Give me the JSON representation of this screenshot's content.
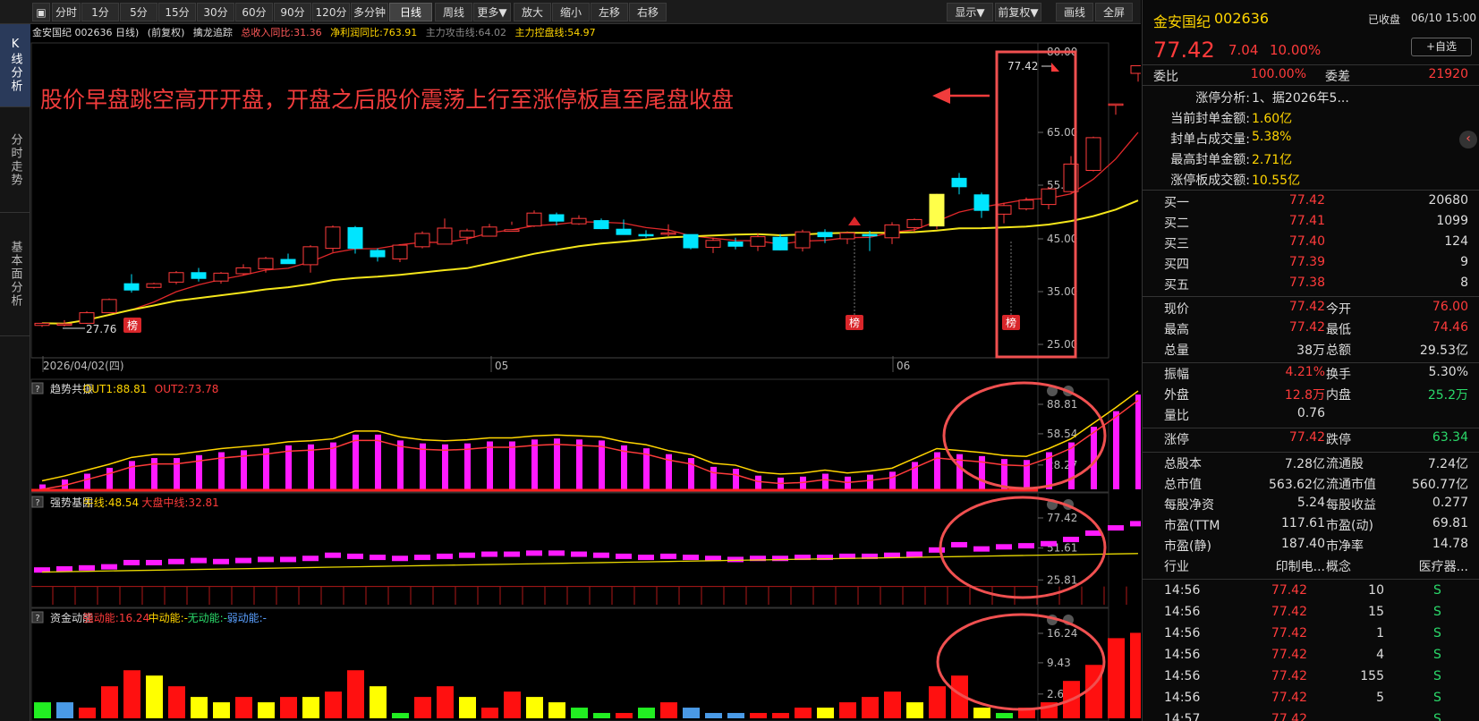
{
  "toolbar": {
    "period_buttons": [
      "分时",
      "1分",
      "5分",
      "15分",
      "30分",
      "60分",
      "90分",
      "120分",
      "多分钟",
      "日线",
      "周线",
      "更多▼",
      "放大",
      "缩小",
      "左移",
      "右移"
    ],
    "active": "日线",
    "right_buttons": [
      "显示▼",
      "前复权▼",
      "画线",
      "全屏"
    ]
  },
  "left_tabs": [
    "K线分析",
    "分时走势",
    "基本面分析"
  ],
  "info_bar": {
    "title": "金安国纪 002636 日线)",
    "fq": "(前复权)",
    "indicator": "擒龙追踪",
    "revenue": "总收入同比:31.36",
    "profit": "净利润同比:763.91",
    "attack": "主力攻击线:64.02",
    "control": "主力控盘线:54.97"
  },
  "annotation": "股价早盘跳空高开开盘，开盘之后股价震荡上行至涨停板直至尾盘收盘",
  "colors": {
    "up": "#ff3b3b",
    "down": "#00e5ff",
    "ma_short": "#e0282a",
    "ma_long": "#f5e61a",
    "magenta": "#ff1aff",
    "circle": "#f05050"
  },
  "chart_data": {
    "type": "candlestick",
    "candles": [
      [
        28.6,
        29.1,
        28.3,
        29.0
      ],
      [
        28.8,
        29.6,
        28.4,
        28.9
      ],
      [
        29.0,
        31.3,
        28.9,
        31.0
      ],
      [
        31.0,
        33.7,
        30.9,
        33.5
      ],
      [
        36.5,
        38.3,
        34.8,
        35.3
      ],
      [
        35.8,
        36.7,
        35.6,
        36.5
      ],
      [
        36.8,
        38.9,
        36.4,
        38.6
      ],
      [
        38.6,
        39.5,
        36.9,
        37.5
      ],
      [
        37.0,
        38.7,
        36.5,
        38.5
      ],
      [
        38.4,
        40.2,
        38.1,
        39.5
      ],
      [
        39.3,
        41.6,
        38.6,
        41.3
      ],
      [
        41.1,
        42.2,
        40.4,
        40.3
      ],
      [
        40.1,
        43.8,
        38.6,
        43.5
      ],
      [
        43.2,
        47.5,
        42.5,
        47.2
      ],
      [
        47.1,
        47.4,
        42.2,
        43.2
      ],
      [
        42.8,
        43.2,
        40.7,
        41.6
      ],
      [
        41.2,
        44.0,
        40.6,
        43.8
      ],
      [
        43.5,
        46.4,
        43.2,
        46.0
      ],
      [
        44.0,
        48.8,
        45.8,
        47.0
      ],
      [
        45.3,
        46.9,
        44.0,
        46.5
      ],
      [
        45.5,
        47.8,
        46.0,
        47.2
      ],
      [
        46.4,
        48.2,
        47.6,
        46.7
      ],
      [
        47.4,
        50.3,
        47.2,
        49.8
      ],
      [
        49.5,
        49.9,
        47.5,
        48.3
      ],
      [
        47.8,
        49.4,
        47.6,
        48.8
      ],
      [
        48.4,
        48.8,
        46.8,
        46.9
      ],
      [
        46.8,
        48.6,
        46.0,
        45.8
      ],
      [
        45.8,
        46.6,
        45.2,
        45.7
      ],
      [
        45.9,
        47.7,
        45.5,
        46.1
      ],
      [
        45.8,
        45.7,
        43.0,
        43.3
      ],
      [
        43.4,
        45.2,
        42.3,
        44.7
      ],
      [
        44.4,
        45.2,
        43.0,
        43.6
      ],
      [
        43.6,
        46.0,
        42.7,
        45.4
      ],
      [
        45.3,
        45.9,
        42.8,
        42.9
      ],
      [
        43.3,
        46.7,
        42.6,
        46.3
      ],
      [
        46.2,
        46.8,
        44.2,
        45.4
      ],
      [
        45.0,
        46.4,
        44.0,
        46.1
      ],
      [
        45.8,
        46.5,
        42.7,
        45.7
      ],
      [
        45.2,
        48.1,
        44.0,
        47.6
      ],
      [
        47.1,
        48.8,
        46.3,
        48.6
      ],
      [
        47.4,
        53.4,
        46.8,
        53.3
      ],
      [
        56.3,
        57.3,
        53.3,
        54.7
      ],
      [
        53.2,
        53.6,
        48.9,
        50.3
      ],
      [
        49.6,
        51.7,
        47.9,
        51.2
      ],
      [
        50.6,
        52.7,
        50.3,
        52.2
      ],
      [
        51.4,
        54.7,
        50.5,
        54.3
      ],
      [
        53.8,
        60.5,
        53.6,
        59.0
      ],
      [
        57.8,
        64.2,
        57.6,
        64.0
      ],
      [
        70.3,
        70.3,
        68.3,
        70.3
      ],
      [
        76.0,
        77.42,
        74.46,
        77.42
      ]
    ],
    "price_axis": [
      "80.00",
      "65.00",
      "55.00",
      "45.00",
      "35.00",
      "25.00"
    ],
    "date_labels": [
      "2026/04/02(四)",
      "05",
      "06"
    ],
    "marks": {
      "low_label": "27.76",
      "high_label": "77.42",
      "badge": "榜"
    },
    "ind1": {
      "name": "趋势共振",
      "out1": "OUT1:88.81",
      "out2": "OUT2:73.78",
      "axis": [
        "88.81",
        "58.54",
        "28.27"
      ],
      "values": [
        5,
        10,
        16,
        22,
        29,
        32,
        32,
        35,
        38,
        40,
        42,
        45,
        46,
        48,
        56,
        56,
        50,
        47,
        46,
        47,
        49,
        49,
        51,
        52,
        51,
        50,
        45,
        42,
        36,
        32,
        23,
        21,
        14,
        12,
        13,
        16,
        13,
        15,
        18,
        28,
        38,
        36,
        34,
        31,
        30,
        38,
        48,
        64,
        80,
        97
      ]
    },
    "ind2": {
      "name": "强势基因",
      "bull": "牛线:48.54",
      "market": "大盘中线:32.81",
      "axis": [
        "77.42",
        "51.61",
        "25.81"
      ],
      "values": [
        33,
        34,
        35,
        36,
        40,
        40,
        41,
        42,
        41,
        42,
        43,
        43,
        44,
        47,
        46,
        45,
        44,
        45,
        46,
        47,
        48,
        48,
        49,
        49,
        48,
        47,
        46,
        45,
        46,
        45,
        44,
        43,
        44,
        44,
        45,
        45,
        46,
        46,
        47,
        48,
        52,
        57,
        53,
        55,
        56,
        58,
        62,
        68,
        73,
        77
      ]
    },
    "ind3": {
      "name": "资金动能",
      "strong": "强动能:16.24",
      "mid": "中动能:-",
      "none": "无动能:-",
      "weak": "弱动能:-",
      "axis": [
        "16.24",
        "9.43",
        "2.62"
      ],
      "values": [
        3,
        3,
        2,
        6,
        9,
        8,
        6,
        4,
        3,
        4,
        3,
        4,
        4,
        5,
        9,
        6,
        1,
        4,
        6,
        4,
        2,
        5,
        4,
        3,
        2,
        1,
        1,
        2,
        3,
        2,
        1,
        1,
        1,
        1,
        2,
        2,
        3,
        4,
        5,
        3,
        6,
        8,
        2,
        1,
        2,
        3,
        7,
        10,
        15,
        16
      ],
      "colors": [
        "G",
        "B",
        "R",
        "R",
        "R",
        "Y",
        "R",
        "Y",
        "Y",
        "R",
        "Y",
        "R",
        "Y",
        "R",
        "R",
        "Y",
        "G",
        "R",
        "R",
        "Y",
        "R",
        "R",
        "Y",
        "Y",
        "G",
        "G",
        "R",
        "G",
        "R",
        "B",
        "B",
        "B",
        "R",
        "R",
        "R",
        "Y",
        "R",
        "R",
        "R",
        "Y",
        "R",
        "R",
        "Y",
        "G",
        "R",
        "R",
        "R",
        "R",
        "R",
        "R"
      ]
    }
  },
  "right": {
    "name": "金安国纪",
    "code": "002636",
    "status": "已收盘",
    "date": "06/10 15:00",
    "price": "77.42",
    "change": "7.04",
    "pct": "10.00%",
    "fav": "+自选",
    "weibi_l": "委比",
    "weibi": "100.00%",
    "weicha_l": "委差",
    "weicha": "21920",
    "limit_rows": [
      [
        "涨停分析:",
        "1、据2026年5..."
      ],
      [
        "当前封单金额:",
        "1.60亿"
      ],
      [
        "封单占成交量:",
        "5.38%"
      ],
      [
        "最高封单金额:",
        "2.71亿"
      ],
      [
        "涨停板成交额:",
        "10.55亿"
      ]
    ],
    "bids": [
      [
        "买一",
        "77.42",
        "20680"
      ],
      [
        "买二",
        "77.41",
        "1099"
      ],
      [
        "买三",
        "77.40",
        "124"
      ],
      [
        "买四",
        "77.39",
        "9"
      ],
      [
        "买五",
        "77.38",
        "8"
      ]
    ],
    "q1": [
      [
        "现价",
        "77.42",
        "今开",
        "76.00"
      ],
      [
        "最高",
        "77.42",
        "最低",
        "74.46"
      ],
      [
        "总量",
        "38万",
        "总额",
        "29.53亿"
      ]
    ],
    "q2": [
      [
        "振幅",
        "4.21%",
        "换手",
        "5.30%"
      ],
      [
        "外盘",
        "12.8万",
        "内盘",
        "25.2万"
      ],
      [
        "量比",
        "0.76",
        "",
        ""
      ]
    ],
    "q3": [
      [
        "涨停",
        "77.42",
        "跌停",
        "63.34"
      ]
    ],
    "q4": [
      [
        "总股本",
        "7.28亿",
        "流通股",
        "7.24亿"
      ],
      [
        "总市值",
        "563.62亿",
        "流通市值",
        "560.77亿"
      ],
      [
        "每股净资",
        "5.24",
        "每股收益",
        "0.277"
      ],
      [
        "市盈(TTM",
        "117.61",
        "市盈(动)",
        "69.81"
      ],
      [
        "市盈(静)",
        "187.40",
        "市净率",
        "14.78"
      ],
      [
        "行业",
        "印制电...",
        "概念",
        "医疗器..."
      ]
    ],
    "ticks": [
      [
        "14:56",
        "77.42",
        "10",
        "S"
      ],
      [
        "14:56",
        "77.42",
        "15",
        "S"
      ],
      [
        "14:56",
        "77.42",
        "1",
        "S"
      ],
      [
        "14:56",
        "77.42",
        "4",
        "S"
      ],
      [
        "14:56",
        "77.42",
        "155",
        "S"
      ],
      [
        "14:56",
        "77.42",
        "5",
        "S"
      ],
      [
        "14:57",
        "77.42",
        "",
        "S"
      ]
    ]
  }
}
